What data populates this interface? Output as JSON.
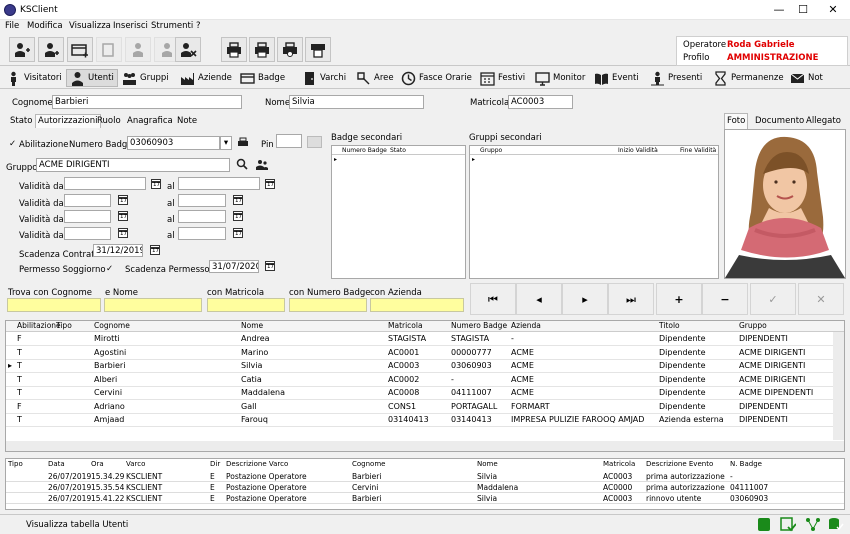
{
  "window": {
    "title": "KSClient",
    "min": "—",
    "max": "☐",
    "close": "✕"
  },
  "menu": [
    "File",
    "Modifica",
    "Visualizza",
    "Inserisci",
    "Strumenti",
    "?"
  ],
  "operator": {
    "operatore_label": "Operatore",
    "operatore_value": "Roda Gabriele",
    "profilo_label": "Profilo",
    "profilo_value": "AMMINISTRAZIONE"
  },
  "nav": [
    "Visitatori",
    "Utenti",
    "Gruppi",
    "Aziende",
    "Badge",
    "Varchi",
    "Aree",
    "Fasce Orarie",
    "Festivi",
    "Monitor",
    "Eventi",
    "Presenti",
    "Permanenze",
    "Not"
  ],
  "form": {
    "cognome_label": "Cognome",
    "cognome": "Barbieri",
    "nome_label": "Nome",
    "nome": "Silvia",
    "matricola_label": "Matricola",
    "matricola": "AC0003"
  },
  "tabs": [
    "Stato",
    "Autorizzazioni",
    "Ruolo",
    "Anagrafica",
    "Note"
  ],
  "auth": {
    "check": "✓",
    "abilitazione": "Abilitazione",
    "numero_badge_label": "Numero Badge",
    "numero_badge": "03060903",
    "pin_label": "Pin",
    "gruppo_label": "Gruppo",
    "gruppo": "ACME DIRIGENTI",
    "validita_label": "Validità dal",
    "al_label": "al",
    "scadenza_contratto_label": "Scadenza Contratto",
    "scadenza_contratto": "31/12/2019",
    "permesso_soggiorno": "Permesso Soggiorno",
    "scadenza_permesso_label": "Scadenza Permesso",
    "scadenza_permesso": "31/07/2020"
  },
  "badge_secondari": {
    "title": "Badge secondari",
    "col1": "Numero Badge",
    "col2": "Stato"
  },
  "gruppi_secondari": {
    "title": "Gruppi secondari",
    "col1": "Gruppo",
    "col2": "Inizio Validità",
    "col3": "Fine Validità"
  },
  "photo_tabs": [
    "Foto",
    "Documento",
    "Allegato"
  ],
  "search": {
    "cognome": "Trova con Cognome",
    "nome": "e Nome",
    "matricola": "con Matricola",
    "badge": "con Numero Badge",
    "azienda": "con Azienda"
  },
  "navbtns": [
    "⏮",
    "◂",
    "▸",
    "⏭",
    "+",
    "−",
    "✓",
    "✕"
  ],
  "grid": {
    "headers": [
      "Abilitazione",
      "Tipo",
      "Cognome",
      "Nome",
      "Matricola",
      "Numero Badge",
      "Azienda",
      "Titolo",
      "Gruppo"
    ],
    "rows": [
      [
        "F",
        "",
        "Mirotti",
        "Andrea",
        "STAGISTA",
        "STAGISTA",
        "-",
        "Dipendente",
        "DIPENDENTI"
      ],
      [
        "T",
        "",
        "Agostini",
        "Marino",
        "AC0001",
        "00000777",
        "ACME",
        "Dipendente",
        "ACME DIRIGENTI"
      ],
      [
        "T",
        "",
        "Barbieri",
        "Silvia",
        "AC0003",
        "03060903",
        "ACME",
        "Dipendente",
        "ACME DIRIGENTI"
      ],
      [
        "T",
        "",
        "Alberi",
        "Catia",
        "AC0002",
        "-",
        "ACME",
        "Dipendente",
        "ACME DIRIGENTI"
      ],
      [
        "T",
        "",
        "Cervini",
        "Maddalena",
        "AC0008",
        "04111007",
        "ACME",
        "Dipendente",
        "ACME DIPENDENTI"
      ],
      [
        "F",
        "",
        "Adriano",
        "Gall",
        "CONS1",
        "PORTAGALL",
        "FORMART",
        "Dipendente",
        "DIPENDENTI"
      ],
      [
        "T",
        "",
        "Amjaad",
        "Farouq",
        "03140413",
        "03140413",
        "IMPRESA PULIZIE FAROOQ AMJAD",
        "Azienda esterna",
        "DIPENDENTI"
      ]
    ],
    "current_marker": "▸"
  },
  "events": {
    "headers": [
      "Tipo",
      "Data",
      "Ora",
      "Varco",
      "Dir",
      "Descrizione Varco",
      "Cognome",
      "Nome",
      "Matricola",
      "Descrizione Evento",
      "N. Badge"
    ],
    "rows": [
      [
        "",
        "26/07/2019",
        "15.34.29",
        "KSCLIENT",
        "E",
        "Postazione Operatore",
        "Barbieri",
        "Silvia",
        "AC0003",
        "prima autorizzazione",
        "-"
      ],
      [
        "",
        "26/07/2019",
        "15.35.54",
        "KSCLIENT",
        "E",
        "Postazione Operatore",
        "Cervini",
        "Maddalena",
        "AC0000",
        "prima autorizzazione",
        "04111007"
      ],
      [
        "",
        "26/07/2019",
        "15.41.22",
        "KSCLIENT",
        "E",
        "Postazione Operatore",
        "Barbieri",
        "Silvia",
        "AC0003",
        "rinnovo utente",
        "03060903"
      ]
    ]
  },
  "status": {
    "text": "Visualizza tabella Utenti"
  }
}
